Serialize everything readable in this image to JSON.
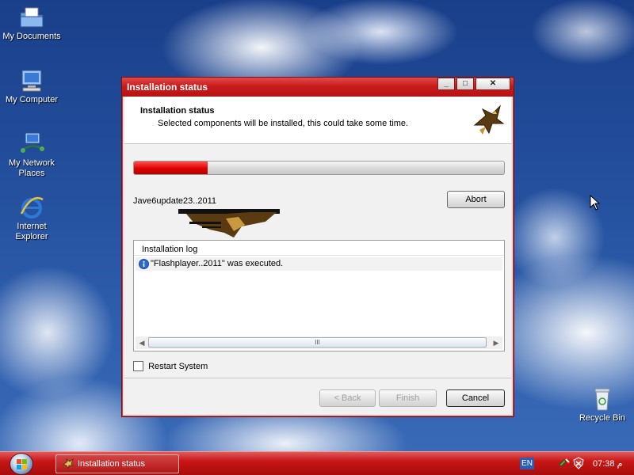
{
  "desktop": {
    "icons": [
      {
        "label": "My Documents",
        "icon": "folder-documents-icon"
      },
      {
        "label": "My Computer",
        "icon": "computer-icon"
      },
      {
        "label": "My Network Places",
        "icon": "network-icon"
      },
      {
        "label": "Internet Explorer",
        "icon": "internet-explorer-icon"
      },
      {
        "label": "Recycle Bin",
        "icon": "recycle-bin-icon"
      }
    ]
  },
  "window": {
    "title": "Installation status",
    "controls": {
      "minimize": "_",
      "maximize": "□",
      "close": "✕"
    },
    "header": {
      "title": "Installation status",
      "subtitle": "Selected components will be installed, this could take some time."
    },
    "progress": {
      "value": 0.2
    },
    "current_file": "Jave6update23..2011",
    "abort_label": "Abort",
    "log": {
      "header": "Installation log",
      "entries": [
        {
          "icon": "info-icon",
          "text": "\"Flashplayer..2011\" was executed."
        }
      ],
      "scroll_thumb": "III"
    },
    "restart_label": "Restart System",
    "buttons": {
      "back": "< Back",
      "finish": "Finish",
      "cancel": "Cancel"
    }
  },
  "taskbar": {
    "task_label": "Installation status",
    "language": "EN",
    "clock": "07:38 م"
  },
  "colors": {
    "accent": "#c81c1c",
    "progress": "#e00000",
    "desktop": "#24509e"
  }
}
